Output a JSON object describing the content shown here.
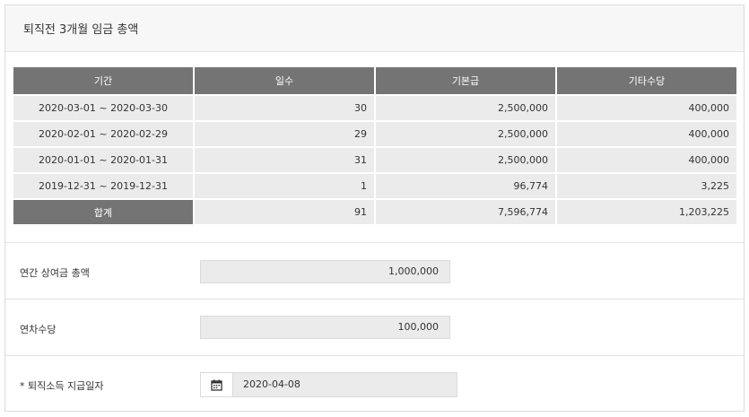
{
  "panel": {
    "title": "퇴직전 3개월 임금 총액"
  },
  "table": {
    "headers": [
      "기간",
      "일수",
      "기본급",
      "기타수당"
    ],
    "rows": [
      [
        "2020-03-01 ~ 2020-03-30",
        "30",
        "2,500,000",
        "400,000"
      ],
      [
        "2020-02-01 ~ 2020-02-29",
        "29",
        "2,500,000",
        "400,000"
      ],
      [
        "2020-01-01 ~ 2020-01-31",
        "31",
        "2,500,000",
        "400,000"
      ],
      [
        "2019-12-31 ~ 2019-12-31",
        "1",
        "96,774",
        "3,225"
      ]
    ],
    "total": {
      "label": "합계",
      "days": "91",
      "base": "7,596,774",
      "other": "1,203,225"
    }
  },
  "bonus": {
    "label": "연간 상여금 총액",
    "value": "1,000,000"
  },
  "annual_leave": {
    "label": "연차수당",
    "value": "100,000"
  },
  "payment_date": {
    "label": "* 퇴직소득 지급일자",
    "value": "2020-04-08",
    "icon": "calendar-icon"
  }
}
